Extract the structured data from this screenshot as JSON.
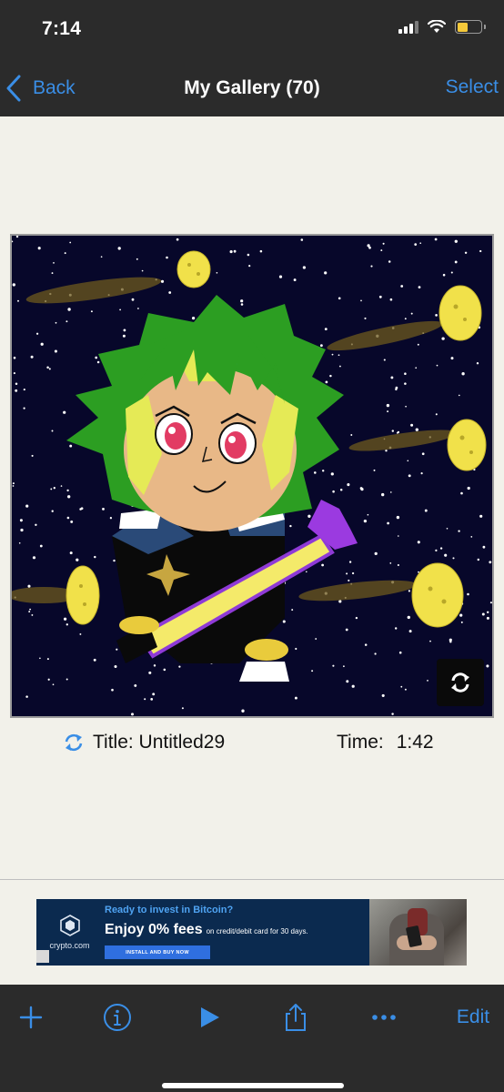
{
  "status_bar": {
    "time": "7:14",
    "signal_icon": "cellular-signal-icon",
    "wifi_icon": "wifi-icon",
    "battery_icon": "battery-icon",
    "battery_level": 0.45,
    "battery_color": "#f5c93a"
  },
  "nav": {
    "back_label": "Back",
    "title": "My Gallery (70)",
    "select_label": "Select",
    "accent_color": "#3a8ee6"
  },
  "artwork": {
    "flip_icon": "rotate-arrows-icon"
  },
  "info": {
    "title_label": "Title: Untitled29",
    "time_label": "Time:",
    "time_value": "1:42"
  },
  "ad": {
    "brand": "crypto.com",
    "headline": "Ready to invest in Bitcoin?",
    "main": "Enjoy 0% fees",
    "main_small": "on credit/debit card for 30 days.",
    "cta": "INSTALL AND BUY NOW"
  },
  "toolbar": {
    "add_icon": "plus-icon",
    "info_icon": "info-icon",
    "play_icon": "play-icon",
    "share_icon": "share-icon",
    "more_icon": "ellipsis-icon",
    "edit_label": "Edit"
  }
}
